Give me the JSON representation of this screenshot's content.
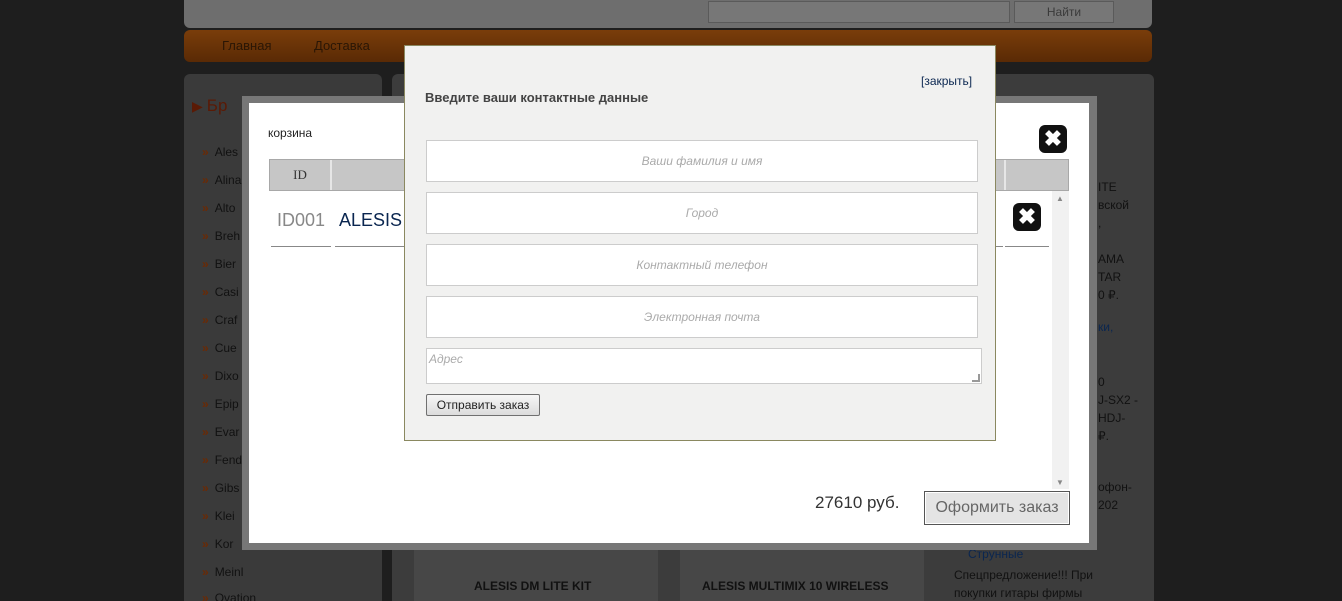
{
  "header": {
    "search_button": "Найти",
    "nav": [
      "Главная",
      "Доставка"
    ]
  },
  "sidebar": {
    "title": "Бр",
    "brands": [
      "Ales",
      "Alina",
      "Alto",
      "Breh",
      "Bier",
      "Casi",
      "Craf",
      "Cue",
      "Dixo",
      "Epip",
      "Evar",
      "Fend",
      "Gibs",
      "Klei",
      "Kor",
      "Meinl",
      "Ovation"
    ]
  },
  "products": [
    {
      "name": "ALESIS DM LITE KIT"
    },
    {
      "name": "ALESIS MULTIMIX 10 WIRELESS"
    }
  ],
  "right_column": {
    "lines": [
      "ITE",
      "вской",
      ",",
      "AMA",
      "TAR",
      "0 ₽.",
      "ки,",
      "0",
      "J-SX2 -",
      "HDJ-",
      "₽.",
      "офон-",
      "202"
    ],
    "link": "Струнные",
    "promo_1": "Спецпредложение!!! При",
    "promo_2": "покупки гитары фирмы"
  },
  "cart": {
    "label": "корзина",
    "col_id": "ID",
    "rows": [
      {
        "id": "ID001",
        "name": "ALESIS"
      }
    ],
    "total": "27610 руб.",
    "checkout_button": "Оформить заказ"
  },
  "contact_dialog": {
    "title": "Введите ваши контактные данные",
    "close_link": "[закрыть]",
    "placeholders": {
      "name": "Ваши фамилия и имя",
      "city": "Город",
      "phone": "Контактный телефон",
      "email": "Электронная почта",
      "address": "Адрес"
    },
    "submit_button": "Отправить заказ"
  }
}
